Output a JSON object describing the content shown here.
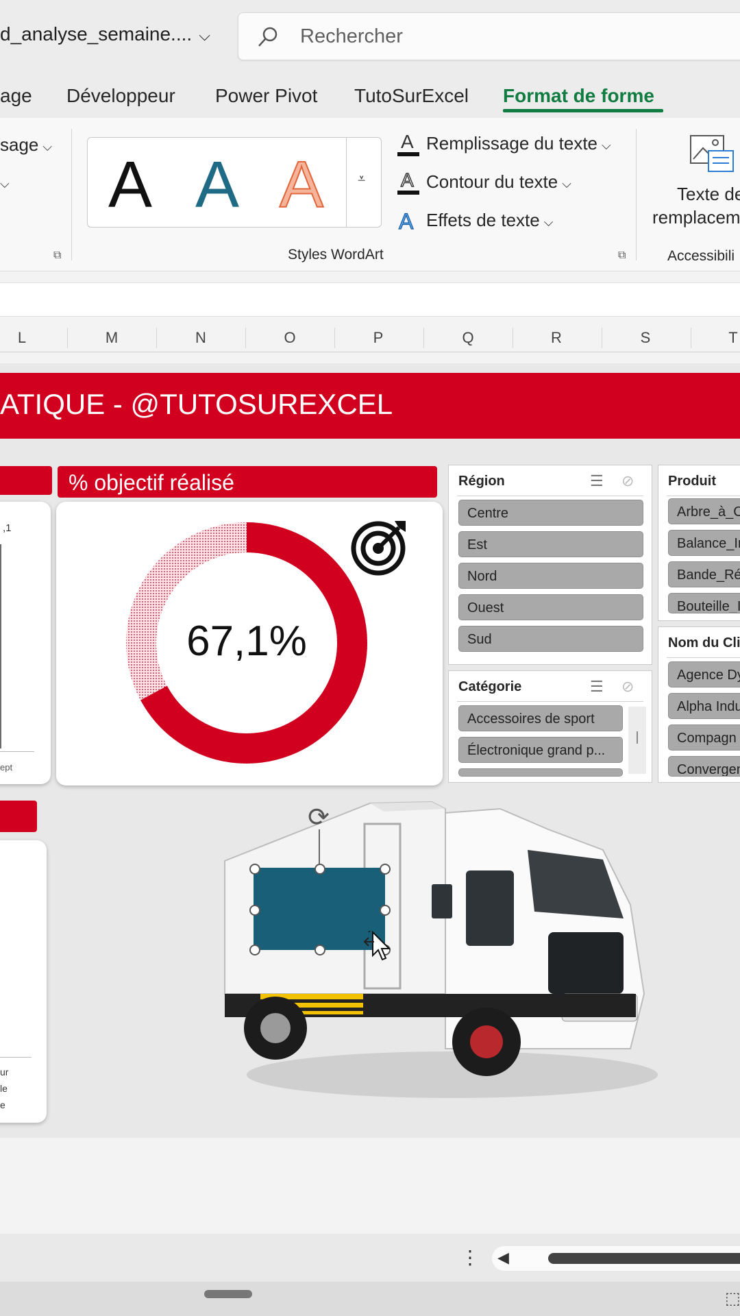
{
  "titlebar": {
    "filename": "d_analyse_semaine....",
    "search_placeholder": "Rechercher"
  },
  "tabs": [
    {
      "label": "age",
      "active": false
    },
    {
      "label": "Développeur",
      "active": false
    },
    {
      "label": "Power Pivot",
      "active": false
    },
    {
      "label": "TutoSurExcel",
      "active": false
    },
    {
      "label": "Format de forme",
      "active": true
    }
  ],
  "ribbon": {
    "left_partial_label": "sage",
    "wordart_group_label": "Styles WordArt",
    "text_fill_label": "Remplissage du texte",
    "text_outline_label": "Contour du texte",
    "text_effects_label": "Effets de texte",
    "alt_text_label_1": "Texte de",
    "alt_text_label_2": "remplacem",
    "accessibility_group_label": "Accessibili",
    "wordart_sample": "A",
    "colors": {
      "black": "#111111",
      "teal": "#1f6a84",
      "orange": "#f08256"
    }
  },
  "columns": [
    "L",
    "M",
    "N",
    "O",
    "P",
    "Q",
    "R",
    "S",
    "T"
  ],
  "dashboard": {
    "banner_text": "ATIQUE - @TUTOSUREXCEL",
    "kpi_title": "% objectif réalisé",
    "kpi_value": "67,1%",
    "kpi_fraction": 0.671,
    "left_chart_partial_label": ",1",
    "left_chart_axis_partial": "ept",
    "left_bottom_partial": [
      "ur",
      "le",
      "e"
    ],
    "accent": "#d1001f"
  },
  "slicers": {
    "region": {
      "title": "Région",
      "items": [
        "Centre",
        "Est",
        "Nord",
        "Ouest",
        "Sud"
      ]
    },
    "categorie": {
      "title": "Catégorie",
      "items": [
        "Accessoires de sport",
        "Électronique grand p..."
      ]
    },
    "produit": {
      "title": "Produit",
      "items": [
        "Arbre_à_C",
        "Balance_In",
        "Bande_Rés",
        "Bouteille_I"
      ]
    },
    "client": {
      "title": "Nom du Clie",
      "items": [
        "Agence Dy",
        "Alpha Indu",
        "Compagn",
        "Convergen"
      ]
    }
  },
  "shape": {
    "fill": "#1a5f78"
  }
}
